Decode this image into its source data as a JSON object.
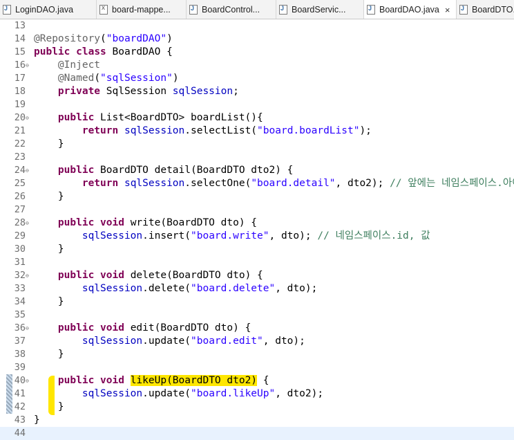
{
  "tabs": [
    {
      "label": "LoginDAO.java",
      "icon": "java-file-icon"
    },
    {
      "label": "board-mappe...",
      "icon": "xml-file-icon"
    },
    {
      "label": "BoardControl...",
      "icon": "java-file-icon"
    },
    {
      "label": "BoardServic...",
      "icon": "java-file-icon"
    },
    {
      "label": "BoardDAO.java",
      "icon": "java-file-icon",
      "active": true,
      "close": "×"
    },
    {
      "label": "BoardDTO.j",
      "icon": "java-file-icon"
    }
  ],
  "code_lines": [
    {
      "n": "13",
      "fold": "",
      "tokens": []
    },
    {
      "n": "14",
      "fold": "",
      "tokens": [
        [
          "an",
          "@Repository"
        ],
        [
          "",
          "("
        ],
        [
          "st",
          "\"boardDAO\""
        ],
        [
          "",
          ")"
        ]
      ]
    },
    {
      "n": "15",
      "fold": "",
      "tokens": [
        [
          "kw",
          "public"
        ],
        [
          "",
          " "
        ],
        [
          "kw",
          "class"
        ],
        [
          "",
          " BoardDAO {"
        ]
      ]
    },
    {
      "n": "16",
      "fold": "⊖",
      "tokens": [
        [
          "",
          "    "
        ],
        [
          "an",
          "@Inject"
        ]
      ]
    },
    {
      "n": "17",
      "fold": "",
      "tokens": [
        [
          "",
          "    "
        ],
        [
          "an",
          "@Named"
        ],
        [
          "",
          "("
        ],
        [
          "st",
          "\"sqlSession\""
        ],
        [
          "",
          ")"
        ]
      ]
    },
    {
      "n": "18",
      "fold": "",
      "tokens": [
        [
          "",
          "    "
        ],
        [
          "kw",
          "private"
        ],
        [
          "",
          " SqlSession "
        ],
        [
          "fd",
          "sqlSession"
        ],
        [
          "",
          ";"
        ]
      ]
    },
    {
      "n": "19",
      "fold": "",
      "tokens": []
    },
    {
      "n": "20",
      "fold": "⊖",
      "tokens": [
        [
          "",
          "    "
        ],
        [
          "kw",
          "public"
        ],
        [
          "",
          " List<BoardDTO> boardList(){"
        ]
      ]
    },
    {
      "n": "21",
      "fold": "",
      "tokens": [
        [
          "",
          "        "
        ],
        [
          "kw",
          "return"
        ],
        [
          "",
          " "
        ],
        [
          "fd",
          "sqlSession"
        ],
        [
          "",
          ".selectList("
        ],
        [
          "st",
          "\"board.boardList\""
        ],
        [
          "",
          ");"
        ]
      ]
    },
    {
      "n": "22",
      "fold": "",
      "tokens": [
        [
          "",
          "    }"
        ]
      ]
    },
    {
      "n": "23",
      "fold": "",
      "tokens": []
    },
    {
      "n": "24",
      "fold": "⊖",
      "tokens": [
        [
          "",
          "    "
        ],
        [
          "kw",
          "public"
        ],
        [
          "",
          " BoardDTO detail(BoardDTO dto2) {"
        ]
      ]
    },
    {
      "n": "25",
      "fold": "",
      "tokens": [
        [
          "",
          "        "
        ],
        [
          "kw",
          "return"
        ],
        [
          "",
          " "
        ],
        [
          "fd",
          "sqlSession"
        ],
        [
          "",
          ".selectOne("
        ],
        [
          "st",
          "\"board.detail\""
        ],
        [
          "",
          ", dto2); "
        ],
        [
          "cm",
          "// 앞에는 네임스페이스.아이디"
        ]
      ]
    },
    {
      "n": "26",
      "fold": "",
      "tokens": [
        [
          "",
          "    }"
        ]
      ]
    },
    {
      "n": "27",
      "fold": "",
      "tokens": []
    },
    {
      "n": "28",
      "fold": "⊖",
      "tokens": [
        [
          "",
          "    "
        ],
        [
          "kw",
          "public"
        ],
        [
          "",
          " "
        ],
        [
          "kw",
          "void"
        ],
        [
          "",
          " write(BoardDTO dto) {"
        ]
      ]
    },
    {
      "n": "29",
      "fold": "",
      "tokens": [
        [
          "",
          "        "
        ],
        [
          "fd",
          "sqlSession"
        ],
        [
          "",
          ".insert("
        ],
        [
          "st",
          "\"board.write\""
        ],
        [
          "",
          ", dto); "
        ],
        [
          "cm",
          "// 네임스페이스.id, 값"
        ]
      ]
    },
    {
      "n": "30",
      "fold": "",
      "tokens": [
        [
          "",
          "    }"
        ]
      ]
    },
    {
      "n": "31",
      "fold": "",
      "tokens": []
    },
    {
      "n": "32",
      "fold": "⊖",
      "tokens": [
        [
          "",
          "    "
        ],
        [
          "kw",
          "public"
        ],
        [
          "",
          " "
        ],
        [
          "kw",
          "void"
        ],
        [
          "",
          " delete(BoardDTO dto) {"
        ]
      ]
    },
    {
      "n": "33",
      "fold": "",
      "tokens": [
        [
          "",
          "        "
        ],
        [
          "fd",
          "sqlSession"
        ],
        [
          "",
          ".delete("
        ],
        [
          "st",
          "\"board.delete\""
        ],
        [
          "",
          ", dto);"
        ]
      ]
    },
    {
      "n": "34",
      "fold": "",
      "tokens": [
        [
          "",
          "    }"
        ]
      ]
    },
    {
      "n": "35",
      "fold": "",
      "tokens": []
    },
    {
      "n": "36",
      "fold": "⊖",
      "tokens": [
        [
          "",
          "    "
        ],
        [
          "kw",
          "public"
        ],
        [
          "",
          " "
        ],
        [
          "kw",
          "void"
        ],
        [
          "",
          " edit(BoardDTO dto) {"
        ]
      ]
    },
    {
      "n": "37",
      "fold": "",
      "tokens": [
        [
          "",
          "        "
        ],
        [
          "fd",
          "sqlSession"
        ],
        [
          "",
          ".update("
        ],
        [
          "st",
          "\"board.edit\""
        ],
        [
          "",
          ", dto);"
        ]
      ]
    },
    {
      "n": "38",
      "fold": "",
      "tokens": [
        [
          "",
          "    }"
        ]
      ]
    },
    {
      "n": "39",
      "fold": "",
      "tokens": []
    },
    {
      "n": "40",
      "fold": "⊖",
      "tokens": [
        [
          "",
          "    "
        ],
        [
          "kw",
          "public"
        ],
        [
          "",
          " "
        ],
        [
          "kw",
          "void"
        ],
        [
          "",
          " "
        ],
        [
          "hl",
          "likeUp(BoardDTO dto2)"
        ],
        [
          "",
          " {"
        ]
      ]
    },
    {
      "n": "41",
      "fold": "",
      "tokens": [
        [
          "",
          "        "
        ],
        [
          "fd",
          "sqlSession"
        ],
        [
          "",
          ".update("
        ],
        [
          "st",
          "\"board.likeUp\""
        ],
        [
          "",
          ", dto2);"
        ]
      ]
    },
    {
      "n": "42",
      "fold": "",
      "tokens": [
        [
          "",
          "    }"
        ]
      ]
    },
    {
      "n": "43",
      "fold": "",
      "tokens": [
        [
          "",
          "}"
        ]
      ]
    },
    {
      "n": "44",
      "fold": "",
      "tokens": [],
      "current": true
    }
  ]
}
